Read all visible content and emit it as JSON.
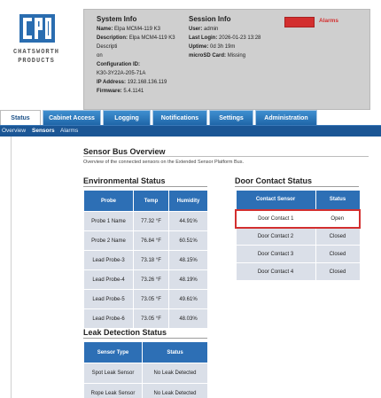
{
  "logo": {
    "brand_line1": "CHATSWORTH",
    "brand_line2": "PRODUCTS"
  },
  "system_info": {
    "heading": "System Info",
    "name_label": "Name:",
    "name": "Elpa MCM4-119 K3",
    "description_label": "Description:",
    "description": "Elpa MCM4-119 K3",
    "line_descripti": "Descripti",
    "line_on": "on",
    "config_label": "Configuration ID:",
    "config_value": "K30-3Y22A-205-71A",
    "ip_label": "IP Address:",
    "ip": "192.168.136.119",
    "firmware_label": "Firmware:",
    "firmware": "5.4.1141"
  },
  "session_info": {
    "heading": "Session Info",
    "user_label": "User:",
    "user": "admin",
    "last_login_label": "Last Login:",
    "last_login": "2026-01-23 13:28",
    "uptime_label": "Uptime:",
    "uptime": "0d 3h 19m",
    "microsd_label": "microSD Card:",
    "microsd": "Missing"
  },
  "alarms": {
    "label": "Alarms",
    "color": "#d32f2f"
  },
  "tabs": [
    {
      "label": "Status",
      "active": true
    },
    {
      "label": "Cabinet Access"
    },
    {
      "label": "Logging"
    },
    {
      "label": "Notifications"
    },
    {
      "label": "Settings"
    },
    {
      "label": "Administration"
    }
  ],
  "subnav": [
    {
      "label": "Overview"
    },
    {
      "label": "Sensors",
      "active": true
    },
    {
      "label": "Alarms"
    }
  ],
  "main": {
    "title": "Sensor Bus Overview",
    "description": "Overview of the connected sensors on the Extended Sensor Platform Bus."
  },
  "environmental": {
    "title": "Environmental Status",
    "headers": [
      "Probe",
      "Temp",
      "Humidity"
    ],
    "rows": [
      [
        "Probe 1 Name",
        "77.32 °F",
        "44.91%"
      ],
      [
        "Probe 2 Name",
        "76.84 °F",
        "60.51%"
      ],
      [
        "Lead Probe-3",
        "73.18 °F",
        "48.15%"
      ],
      [
        "Lead Probe-4",
        "73.26 °F",
        "48.19%"
      ],
      [
        "Lead Probe-5",
        "73.05 °F",
        "49.61%"
      ],
      [
        "Lead Probe-6",
        "73.05 °F",
        "48.03%"
      ]
    ]
  },
  "door_contact": {
    "title": "Door Contact Status",
    "headers": [
      "Contact Sensor",
      "Status"
    ],
    "rows": [
      [
        "Door Contact 1",
        "Open"
      ],
      [
        "Door Contact 2",
        "Closed"
      ],
      [
        "Door Contact 3",
        "Closed"
      ],
      [
        "Door Contact 4",
        "Closed"
      ]
    ]
  },
  "leak_detection": {
    "title": "Leak Detection Status",
    "headers": [
      "Sensor Type",
      "Status"
    ],
    "rows": [
      [
        "Spot Leak Sensor",
        "No Leak Detected"
      ],
      [
        "Rope Leak Sensor",
        "No Leak Detected"
      ]
    ]
  },
  "colors": {
    "accent_blue": "#2d6fb5",
    "nav_blue": "#1b5695",
    "alert_red": "#d32f2f",
    "logo_blue": "#2a6db0"
  }
}
